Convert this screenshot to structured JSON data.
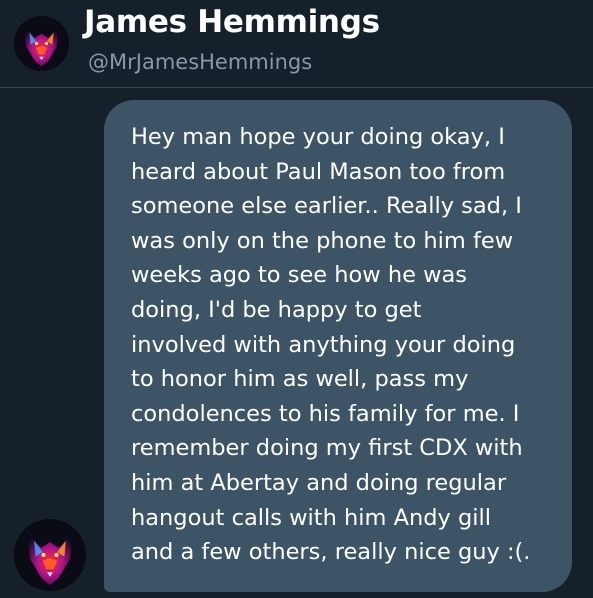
{
  "profile": {
    "display_name": "James Hemmings",
    "handle": "@MrJamesHemmings",
    "avatar_icon": "wolf-avatar-icon"
  },
  "message": {
    "lines": [
      "Hey man hope your doing okay, I",
      "heard about Paul Mason too from",
      "someone else earlier.. Really sad, I",
      "was only on the phone to him few",
      "weeks ago to see how he was",
      "doing, I'd be happy to get",
      "involved with anything your doing",
      "to honor him as well, pass my",
      "condolences to his family for me. I",
      "remember doing my first CDX with",
      "him at Abertay and doing regular",
      "hangout calls with him Andy gill",
      "and a few others, really nice guy :(."
    ]
  },
  "colors": {
    "background": "#15202b",
    "bubble": "#3d5466",
    "handle": "#8899a6",
    "text": "#ffffff"
  }
}
